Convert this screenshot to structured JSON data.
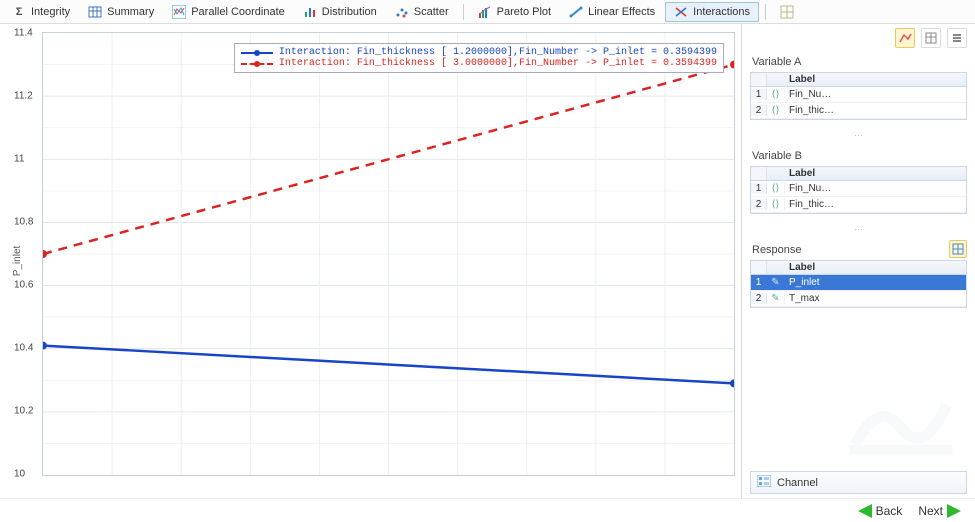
{
  "toolbar": {
    "items": [
      {
        "label": "Integrity"
      },
      {
        "label": "Summary"
      },
      {
        "label": "Parallel Coordinate"
      },
      {
        "label": "Distribution"
      },
      {
        "label": "Scatter"
      },
      {
        "label": "Pareto Plot"
      },
      {
        "label": "Linear Effects"
      },
      {
        "label": "Interactions"
      }
    ]
  },
  "chart_data": {
    "type": "line",
    "ylabel": "P_inlet",
    "ylim": [
      10.0,
      11.4
    ],
    "yticks": [
      10.0,
      10.2,
      10.4,
      10.6,
      10.8,
      11.0,
      11.2,
      11.4
    ],
    "x": [
      0,
      1
    ],
    "series": [
      {
        "name": "Interaction: Fin_thickness [ 1.2000000],Fin_Number -> P_inlet =  0.3594399",
        "color": "#1844c7",
        "dashed": false,
        "values": [
          10.41,
          10.29
        ]
      },
      {
        "name": "Interaction: Fin_thickness [ 3.0000000],Fin_Number -> P_inlet =  0.3594399",
        "color": "#d22626",
        "dashed": true,
        "values": [
          10.7,
          11.3
        ]
      }
    ]
  },
  "panels": {
    "varA": {
      "title": "Variable A",
      "header": "Label",
      "rows": [
        "Fin_Nu…",
        "Fin_thic…"
      ]
    },
    "varB": {
      "title": "Variable B",
      "header": "Label",
      "rows": [
        "Fin_Nu…",
        "Fin_thic…"
      ]
    },
    "response": {
      "title": "Response",
      "header": "Label",
      "rows": [
        "P_inlet",
        "T_max"
      ],
      "selected": 0
    }
  },
  "channel": {
    "label": "Channel"
  },
  "footer": {
    "back": "Back",
    "next": "Next"
  }
}
